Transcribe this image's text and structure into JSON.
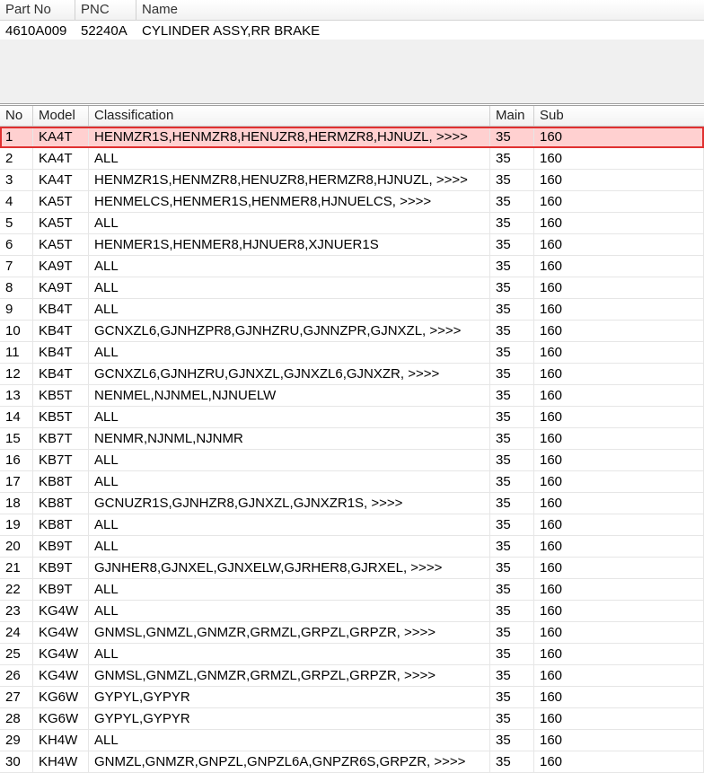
{
  "part_header": {
    "columns": [
      "Part No",
      "PNC",
      "Name"
    ],
    "part_no": "4610A009",
    "pnc": "52240A",
    "name": "CYLINDER ASSY,RR BRAKE"
  },
  "list": {
    "columns": [
      "No",
      "Model",
      "Classification",
      "Main",
      "Sub"
    ],
    "selected_index": 0,
    "rows": [
      {
        "no": "1",
        "model": "KA4T",
        "classification": "HENMZR1S,HENMZR8,HENUZR8,HERMZR8,HJNUZL,  >>>>",
        "main": "35",
        "sub": "160"
      },
      {
        "no": "2",
        "model": "KA4T",
        "classification": "ALL",
        "main": "35",
        "sub": "160"
      },
      {
        "no": "3",
        "model": "KA4T",
        "classification": "HENMZR1S,HENMZR8,HENUZR8,HERMZR8,HJNUZL,  >>>>",
        "main": "35",
        "sub": "160"
      },
      {
        "no": "4",
        "model": "KA5T",
        "classification": "HENMELCS,HENMER1S,HENMER8,HJNUELCS,  >>>>",
        "main": "35",
        "sub": "160"
      },
      {
        "no": "5",
        "model": "KA5T",
        "classification": "ALL",
        "main": "35",
        "sub": "160"
      },
      {
        "no": "6",
        "model": "KA5T",
        "classification": "HENMER1S,HENMER8,HJNUER8,XJNUER1S",
        "main": "35",
        "sub": "160"
      },
      {
        "no": "7",
        "model": "KA9T",
        "classification": "ALL",
        "main": "35",
        "sub": "160"
      },
      {
        "no": "8",
        "model": "KA9T",
        "classification": "ALL",
        "main": "35",
        "sub": "160"
      },
      {
        "no": "9",
        "model": "KB4T",
        "classification": "ALL",
        "main": "35",
        "sub": "160"
      },
      {
        "no": "10",
        "model": "KB4T",
        "classification": "GCNXZL6,GJNHZPR8,GJNHZRU,GJNNZPR,GJNXZL,  >>>>",
        "main": "35",
        "sub": "160"
      },
      {
        "no": "11",
        "model": "KB4T",
        "classification": "ALL",
        "main": "35",
        "sub": "160"
      },
      {
        "no": "12",
        "model": "KB4T",
        "classification": "GCNXZL6,GJNHZRU,GJNXZL,GJNXZL6,GJNXZR,  >>>>",
        "main": "35",
        "sub": "160"
      },
      {
        "no": "13",
        "model": "KB5T",
        "classification": "NENMEL,NJNMEL,NJNUELW",
        "main": "35",
        "sub": "160"
      },
      {
        "no": "14",
        "model": "KB5T",
        "classification": "ALL",
        "main": "35",
        "sub": "160"
      },
      {
        "no": "15",
        "model": "KB7T",
        "classification": "NENMR,NJNML,NJNMR",
        "main": "35",
        "sub": "160"
      },
      {
        "no": "16",
        "model": "KB7T",
        "classification": "ALL",
        "main": "35",
        "sub": "160"
      },
      {
        "no": "17",
        "model": "KB8T",
        "classification": "ALL",
        "main": "35",
        "sub": "160"
      },
      {
        "no": "18",
        "model": "KB8T",
        "classification": "GCNUZR1S,GJNHZR8,GJNXZL,GJNXZR1S,  >>>>",
        "main": "35",
        "sub": "160"
      },
      {
        "no": "19",
        "model": "KB8T",
        "classification": "ALL",
        "main": "35",
        "sub": "160"
      },
      {
        "no": "20",
        "model": "KB9T",
        "classification": "ALL",
        "main": "35",
        "sub": "160"
      },
      {
        "no": "21",
        "model": "KB9T",
        "classification": "GJNHER8,GJNXEL,GJNXELW,GJRHER8,GJRXEL,  >>>>",
        "main": "35",
        "sub": "160"
      },
      {
        "no": "22",
        "model": "KB9T",
        "classification": "ALL",
        "main": "35",
        "sub": "160"
      },
      {
        "no": "23",
        "model": "KG4W",
        "classification": "ALL",
        "main": "35",
        "sub": "160"
      },
      {
        "no": "24",
        "model": "KG4W",
        "classification": "GNMSL,GNMZL,GNMZR,GRMZL,GRPZL,GRPZR,  >>>>",
        "main": "35",
        "sub": "160"
      },
      {
        "no": "25",
        "model": "KG4W",
        "classification": "ALL",
        "main": "35",
        "sub": "160"
      },
      {
        "no": "26",
        "model": "KG4W",
        "classification": "GNMSL,GNMZL,GNMZR,GRMZL,GRPZL,GRPZR,  >>>>",
        "main": "35",
        "sub": "160"
      },
      {
        "no": "27",
        "model": "KG6W",
        "classification": "GYPYL,GYPYR",
        "main": "35",
        "sub": "160"
      },
      {
        "no": "28",
        "model": "KG6W",
        "classification": "GYPYL,GYPYR",
        "main": "35",
        "sub": "160"
      },
      {
        "no": "29",
        "model": "KH4W",
        "classification": "ALL",
        "main": "35",
        "sub": "160"
      },
      {
        "no": "30",
        "model": "KH4W",
        "classification": "GNMZL,GNMZR,GNPZL,GNPZL6A,GNPZR6S,GRPZR,  >>>>",
        "main": "35",
        "sub": "160"
      }
    ]
  },
  "colors": {
    "selected_row_bg": "#ffd0d0",
    "selected_row_border": "#e03030"
  }
}
